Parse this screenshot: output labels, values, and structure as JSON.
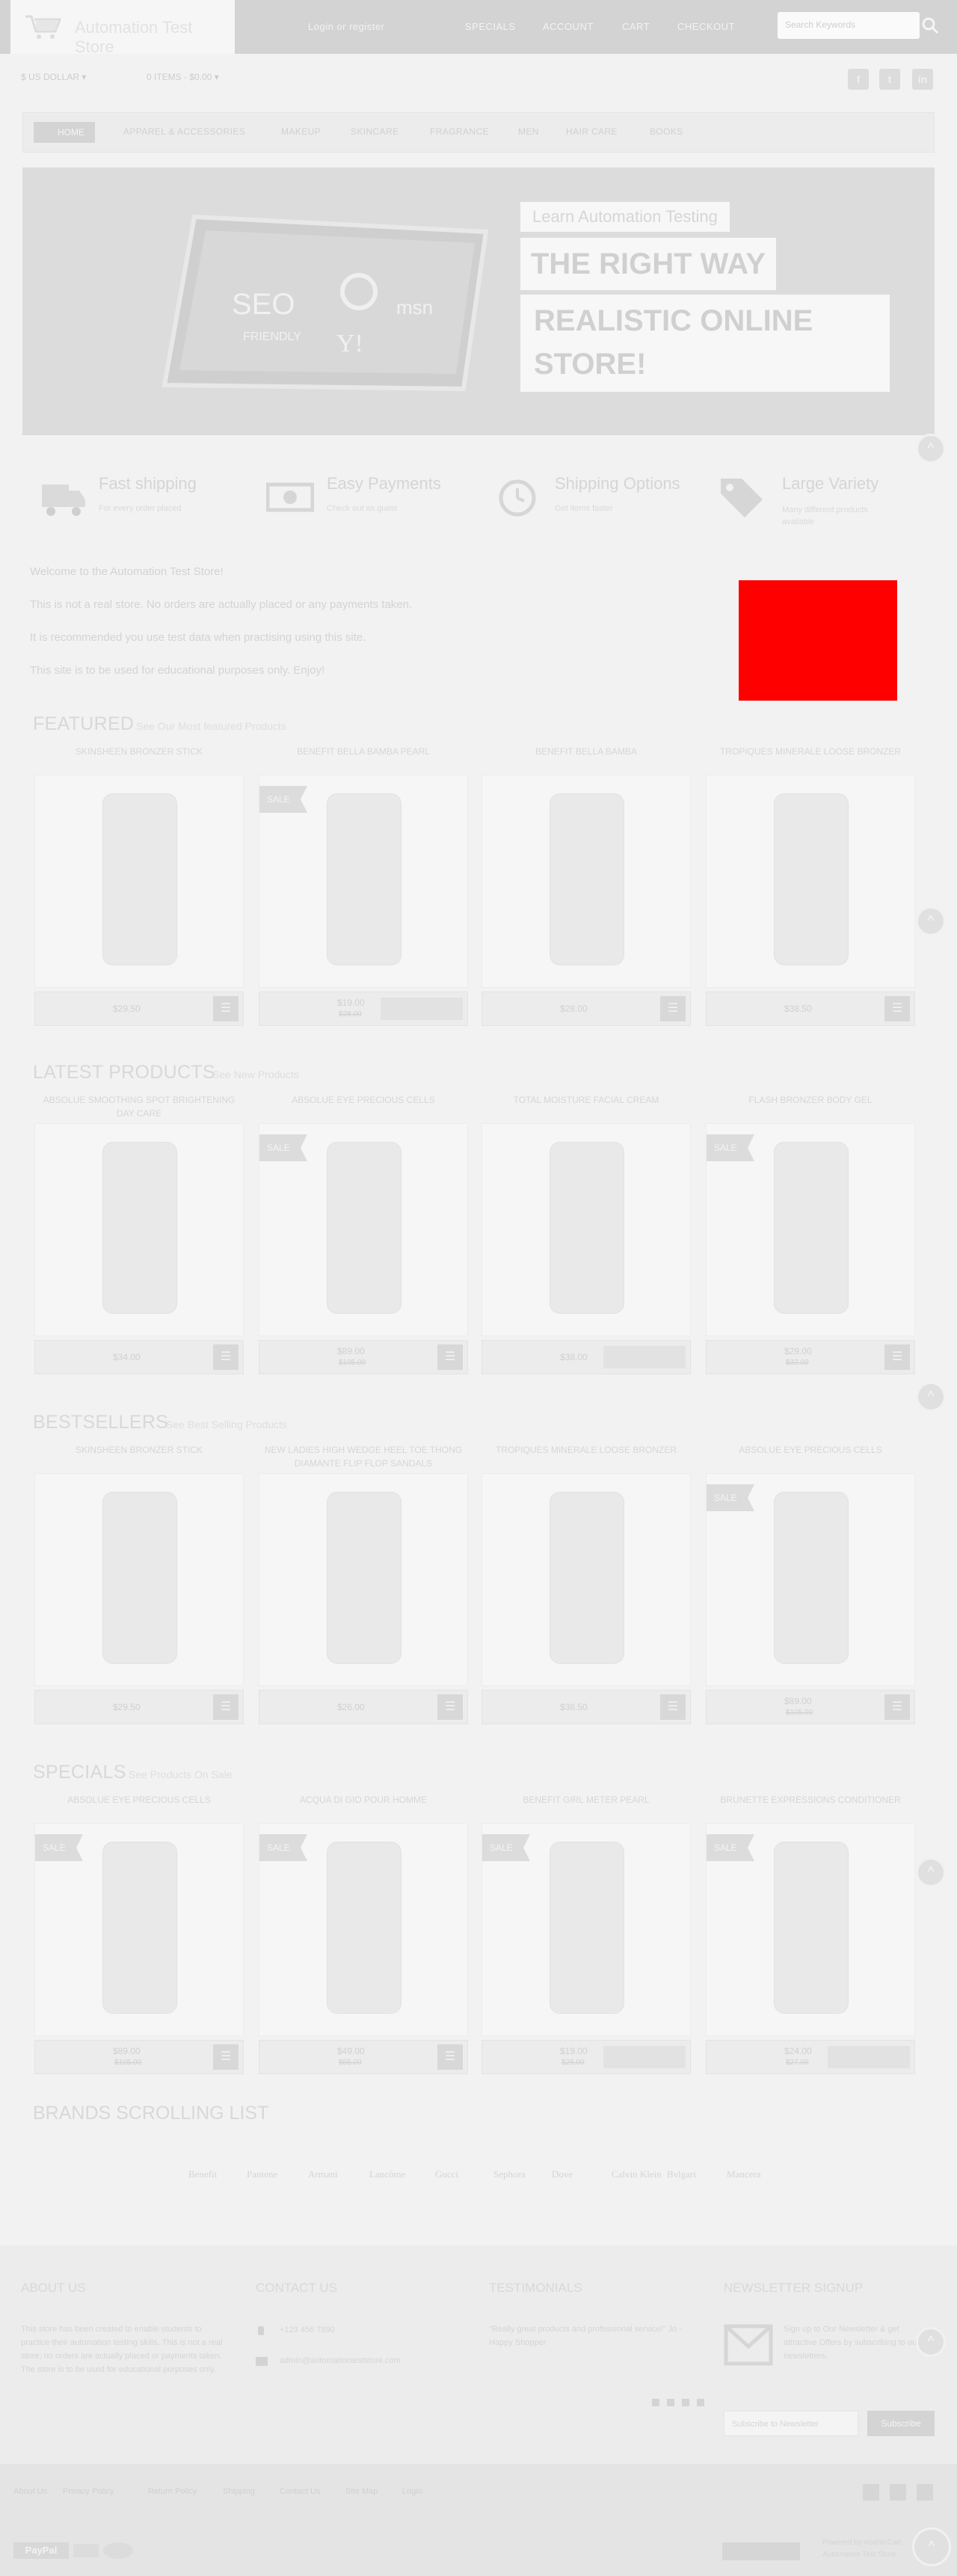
{
  "header": {
    "logo_text": "Automation Test Store",
    "login": "Login or register",
    "links": [
      "SPECIALS",
      "ACCOUNT",
      "CART",
      "CHECKOUT"
    ],
    "search_placeholder": "Search Keywords"
  },
  "toolbar": {
    "currency": "$ US DOLLAR ▾",
    "cart_summary": "0 ITEMS - $0.00 ▾",
    "social": [
      "f",
      "t",
      "in"
    ]
  },
  "nav": {
    "items": [
      "HOME",
      "APPAREL & ACCESSORIES",
      "MAKEUP",
      "SKINCARE",
      "FRAGRANCE",
      "MEN",
      "HAIR CARE",
      "BOOKS"
    ]
  },
  "banner": {
    "line1": "Learn Automation Testing",
    "line2": "THE RIGHT WAY",
    "line3": "REALISTIC ONLINE STORE!",
    "tablet_words": [
      "SEO",
      "FRIENDLY",
      "msn",
      "Y!"
    ]
  },
  "features": [
    {
      "title": "Fast shipping",
      "sub": "For every order placed"
    },
    {
      "title": "Easy Payments",
      "sub": "Check out as guest"
    },
    {
      "title": "Shipping Options",
      "sub": "Get items faster"
    },
    {
      "title": "Large Variety",
      "sub": "Many different products available"
    }
  ],
  "welcome": [
    "Welcome to the Automation Test Store!",
    "This is not a real store. No orders are actually placed or any payments taken.",
    "It is recommended you use test data when practising using this site.",
    "This site is to be used for educational purposes only. Enjoy!"
  ],
  "sections": [
    {
      "title": "FEATURED",
      "sub": "See Our Most featured Products",
      "products": [
        {
          "name": "SKINSHEEN BRONZER STICK",
          "price": "$29.50",
          "old": "",
          "sale": "",
          "cart": true
        },
        {
          "name": "BENEFIT BELLA BAMBA PEARL",
          "price": "$19.00",
          "old": "$28.00",
          "sale": "SALE",
          "cart": false
        },
        {
          "name": "BENEFIT BELLA BAMBA",
          "price": "$28.00",
          "old": "",
          "sale": "",
          "cart": true
        },
        {
          "name": "TROPIQUES MINERALE LOOSE BRONZER",
          "price": "$38.50",
          "old": "",
          "sale": "",
          "cart": true
        }
      ]
    },
    {
      "title": "LATEST PRODUCTS",
      "sub": "See New Products",
      "products": [
        {
          "name": "ABSOLUE SMOOTHING SPOT BRIGHTENING DAY CARE",
          "price": "$34.00",
          "old": "",
          "sale": "",
          "cart": true
        },
        {
          "name": "ABSOLUE EYE PRECIOUS CELLS",
          "price": "$89.00",
          "old": "$105.00",
          "sale": "SALE",
          "cart": true
        },
        {
          "name": "TOTAL MOISTURE FACIAL CREAM",
          "price": "$38.00",
          "old": "",
          "sale": "",
          "cart": false
        },
        {
          "name": "FLASH BRONZER BODY GEL",
          "price": "$29.00",
          "old": "$32.00",
          "sale": "SALE",
          "cart": true
        }
      ]
    },
    {
      "title": "BESTSELLERS",
      "sub": "See Best Selling Products",
      "products": [
        {
          "name": "SKINSHEEN BRONZER STICK",
          "price": "$29.50",
          "old": "",
          "sale": "",
          "cart": true
        },
        {
          "name": "NEW LADIES HIGH WEDGE HEEL TOE THONG DIAMANTE FLIP FLOP SANDALS",
          "price": "$26.00",
          "old": "",
          "sale": "",
          "cart": true
        },
        {
          "name": "TROPIQUES MINERALE LOOSE BRONZER",
          "price": "$38.50",
          "old": "",
          "sale": "",
          "cart": true
        },
        {
          "name": "ABSOLUE EYE PRECIOUS CELLS",
          "price": "$89.00",
          "old": "$105.00",
          "sale": "SALE",
          "cart": true
        }
      ]
    },
    {
      "title": "SPECIALS",
      "sub": "See Products On Sale",
      "products": [
        {
          "name": "ABSOLUE EYE PRECIOUS CELLS",
          "price": "$89.00",
          "old": "$105.00",
          "sale": "SALE",
          "cart": true
        },
        {
          "name": "ACQUA DI GIO POUR HOMME",
          "price": "$49.00",
          "old": "$55.00",
          "sale": "SALE",
          "cart": true
        },
        {
          "name": "BENEFIT GIRL METER PEARL",
          "price": "$19.00",
          "old": "$28.00",
          "sale": "SALE",
          "cart": false
        },
        {
          "name": "BRUNETTE EXPRESSIONS CONDITIONER",
          "price": "$24.00",
          "old": "$27.00",
          "sale": "SALE",
          "cart": false
        }
      ]
    }
  ],
  "brands": {
    "title": "BRANDS SCROLLING LIST",
    "items": [
      "Benefit",
      "Pantene",
      "Armani",
      "Lancôme",
      "Gucci",
      "Sephora",
      "Dove",
      "Calvin Klein",
      "Bvlgari",
      "Mancera"
    ]
  },
  "footer": {
    "about_title": "ABOUT US",
    "about_text": "This store has been created to enable students to practice their automation testing skills. This is not a real store; no orders are actually placed or payments taken. The store is to be used for educational purposes only.",
    "contact_title": "CONTACT US",
    "phone": "+123 456 7890",
    "email": "admin@automationteststore.com",
    "testimonials_title": "TESTIMONIALS",
    "testimonial": "\"Really great products and professional service!\" Jo - Happy Shopper",
    "newsletter_title": "NEWSLETTER SIGNUP",
    "newsletter_text": "Sign up to Our Newsletter & get attractive Offers by subscribing to our newsletters.",
    "newsletter_placeholder": "Subscribe to Newsletter",
    "subscribe": "Subscribe",
    "links": [
      "About Us",
      "Privacy Policy",
      "Return Policy",
      "Shipping",
      "Contact Us",
      "Site Map",
      "Login"
    ],
    "copyright": "Powered by AbanteCart",
    "copyright2": "Automation Test Store",
    "paypal": "PayPal"
  },
  "colors": {
    "page_bg": "#f2f2f2",
    "red_box": "#ff0000",
    "topbar": "#d3d3d3"
  }
}
